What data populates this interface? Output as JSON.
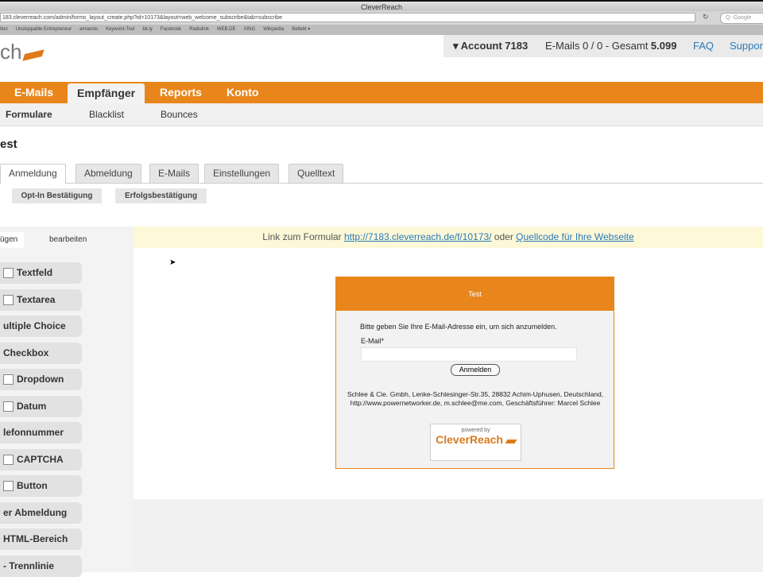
{
  "browser": {
    "title": "CleverReach",
    "url": "183.cleverreach.com/admin/forms_layout_create.php?id=10173&layout=web_welcome_subscribe&tab=subscribe",
    "search_placeholder": "Q- Google",
    "bookmarks": [
      "tion",
      "Unstoppable Entrepreneur",
      "amiando",
      "Keyword-Tool",
      "bit.ly",
      "Facebook",
      "Radiolink",
      "WEB.DE",
      "XING",
      "Wikipedia",
      "Beliebt ▾"
    ]
  },
  "logo": {
    "text": "ch"
  },
  "account": {
    "label": "▾ Account 7183",
    "emails": "E-Mails 0 / 0 - Gesamt ",
    "total": "5.099",
    "faq": "FAQ",
    "support": "Support"
  },
  "nav": [
    "E-Mails",
    "Empfänger",
    "Reports",
    "Konto"
  ],
  "subnav": [
    "Formulare",
    "Blacklist",
    "Bounces"
  ],
  "page_title": "est",
  "tabs": [
    "Anmeldung",
    "Abmeldung",
    "E-Mails",
    "Einstellungen",
    "Quelltext"
  ],
  "sub_buttons": [
    "Opt-In Bestätigung",
    "Erfolgsbestätigung"
  ],
  "linkbar": {
    "prefix": "Link zum Formular ",
    "url": "http://7183.cleverreach.de/f/10173/",
    "middle": " oder ",
    "source": "Quellcode für Ihre Webseite"
  },
  "left_tabs": [
    "ügen",
    "bearbeiten"
  ],
  "elements": [
    "Textfeld",
    "Textarea",
    "ultiple Choice",
    "Checkbox",
    "Dropdown",
    "Datum",
    "lefonnummer",
    "CAPTCHA",
    "Button",
    "er Abmeldung",
    "HTML-Bereich",
    "- Trennlinie"
  ],
  "form": {
    "title": "Test",
    "intro": "Bitte geben Sie Ihre E-Mail-Adresse ein, um sich anzumelden.",
    "email_label": "E-Mail*",
    "email_value": "",
    "submit": "Anmelden",
    "address": "Schlee & Cie. Gmbh, Lenke-Schlesinger-Str.35, 28832 Achim-Uphusen, Deutschland, http://www.powernetworker.de, m.schlee@me.com, Geschäftsführer: Marcel Schlee",
    "powered": "powered by",
    "brand": "CleverReach"
  }
}
